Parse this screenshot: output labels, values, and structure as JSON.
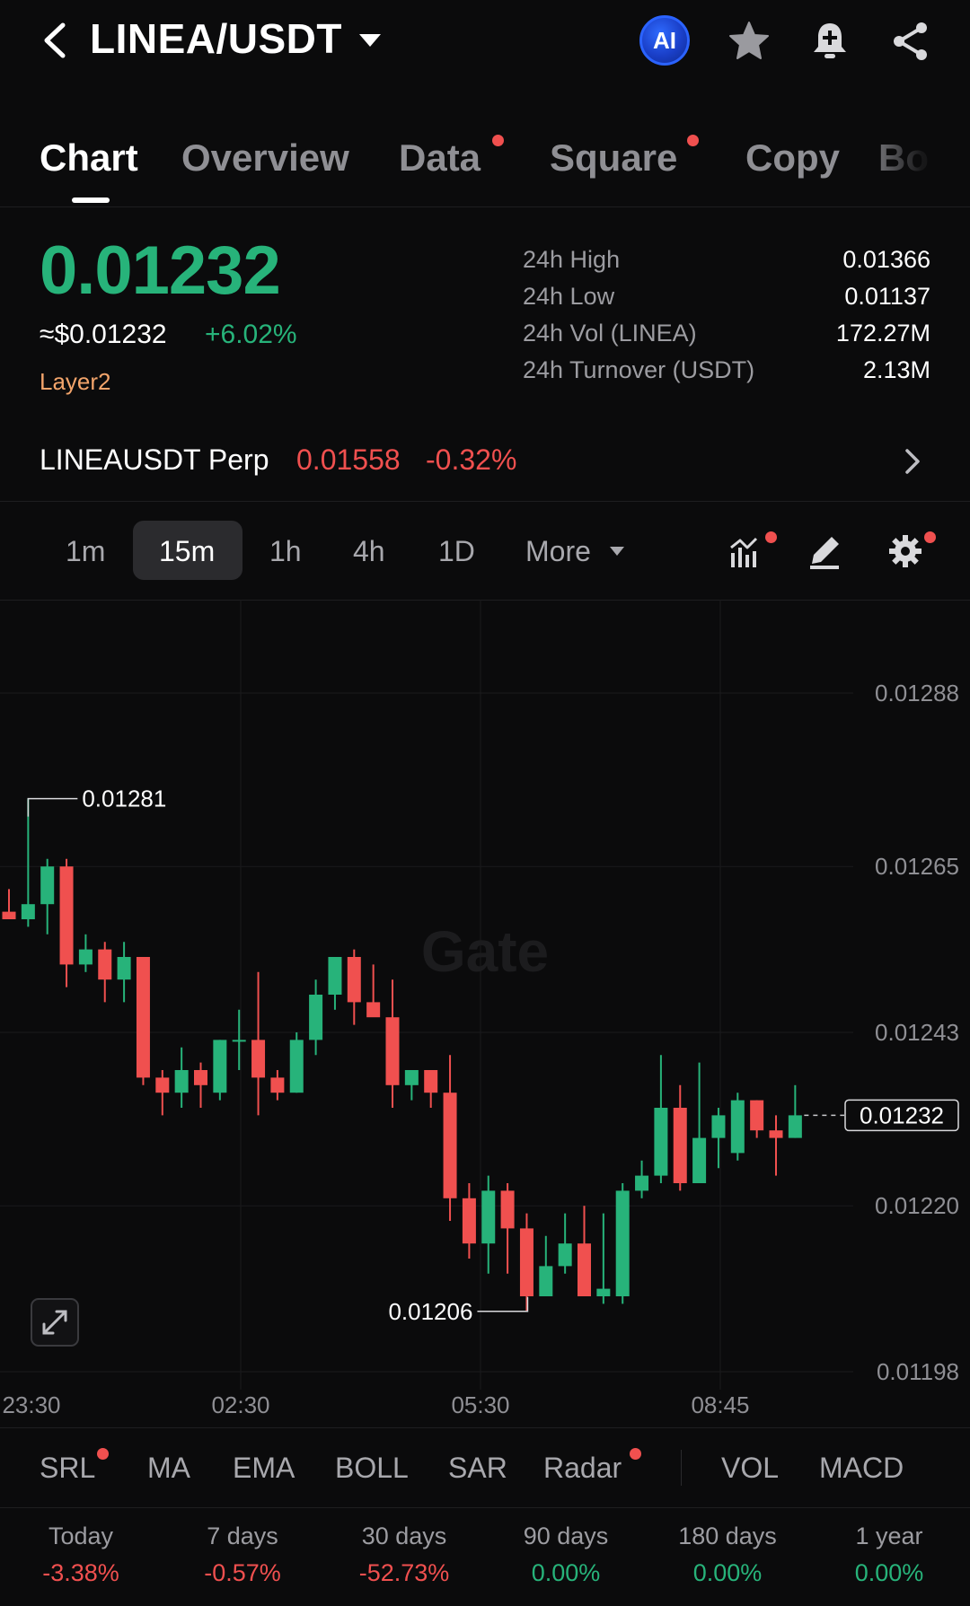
{
  "header": {
    "pair": "LINEA/USDT",
    "ai_label": "AI"
  },
  "tabs": [
    {
      "label": "Chart",
      "active": true,
      "dot": false
    },
    {
      "label": "Overview",
      "active": false,
      "dot": false
    },
    {
      "label": "Data",
      "active": false,
      "dot": true
    },
    {
      "label": "Square",
      "active": false,
      "dot": true
    },
    {
      "label": "Copy",
      "active": false,
      "dot": false
    },
    {
      "label": "Bo",
      "active": false,
      "dot": false
    }
  ],
  "price": {
    "last": "0.01232",
    "usd": "≈$0.01232",
    "change": "+6.02%",
    "tag": "Layer2"
  },
  "stats": [
    {
      "label": "24h High",
      "value": "0.01366"
    },
    {
      "label": "24h Low",
      "value": "0.01137"
    },
    {
      "label": "24h Vol (LINEA)",
      "value": "172.27M"
    },
    {
      "label": "24h Turnover (USDT)",
      "value": "2.13M"
    }
  ],
  "perp": {
    "name": "LINEAUSDT Perp",
    "price": "0.01558",
    "change": "-0.32%"
  },
  "intervals": [
    "1m",
    "15m",
    "1h",
    "4h",
    "1D"
  ],
  "interval_active": "15m",
  "more_label": "More",
  "colors": {
    "up": "#27b37a",
    "down": "#f0504f",
    "tag": "#f2a46b",
    "dot": "#f0504f"
  },
  "chart_data": {
    "type": "candlestick",
    "watermark": "Gate",
    "price_axis": [
      "0.01288",
      "0.01265",
      "0.01243",
      "0.01220",
      "0.01198"
    ],
    "ylim": [
      0.01198,
      0.01288
    ],
    "time_axis": [
      "23:30",
      "02:30",
      "05:30",
      "08:45"
    ],
    "high_marker": "0.01281",
    "low_marker": "0.01206",
    "current_price": "0.01232",
    "candles": [
      {
        "o": 0.01259,
        "h": 0.01262,
        "l": 0.01258,
        "c": 0.01258
      },
      {
        "o": 0.01258,
        "h": 0.01274,
        "l": 0.01257,
        "c": 0.0126
      },
      {
        "o": 0.0126,
        "h": 0.01266,
        "l": 0.01256,
        "c": 0.01265
      },
      {
        "o": 0.01265,
        "h": 0.01266,
        "l": 0.01249,
        "c": 0.01252
      },
      {
        "o": 0.01252,
        "h": 0.01256,
        "l": 0.01251,
        "c": 0.01254
      },
      {
        "o": 0.01254,
        "h": 0.01255,
        "l": 0.01247,
        "c": 0.0125
      },
      {
        "o": 0.0125,
        "h": 0.01255,
        "l": 0.01247,
        "c": 0.01253
      },
      {
        "o": 0.01253,
        "h": 0.01253,
        "l": 0.01236,
        "c": 0.01237
      },
      {
        "o": 0.01237,
        "h": 0.01238,
        "l": 0.01232,
        "c": 0.01235
      },
      {
        "o": 0.01235,
        "h": 0.01241,
        "l": 0.01233,
        "c": 0.01238
      },
      {
        "o": 0.01238,
        "h": 0.01239,
        "l": 0.01233,
        "c": 0.01236
      },
      {
        "o": 0.01235,
        "h": 0.01242,
        "l": 0.01234,
        "c": 0.01242
      },
      {
        "o": 0.01242,
        "h": 0.01246,
        "l": 0.01238,
        "c": 0.01242
      },
      {
        "o": 0.01242,
        "h": 0.01251,
        "l": 0.01232,
        "c": 0.01237
      },
      {
        "o": 0.01237,
        "h": 0.01238,
        "l": 0.01234,
        "c": 0.01235
      },
      {
        "o": 0.01235,
        "h": 0.01243,
        "l": 0.01235,
        "c": 0.01242
      },
      {
        "o": 0.01242,
        "h": 0.0125,
        "l": 0.0124,
        "c": 0.01248
      },
      {
        "o": 0.01248,
        "h": 0.01252,
        "l": 0.01246,
        "c": 0.01253
      },
      {
        "o": 0.01253,
        "h": 0.01254,
        "l": 0.01244,
        "c": 0.01247
      },
      {
        "o": 0.01247,
        "h": 0.01252,
        "l": 0.01246,
        "c": 0.01245
      },
      {
        "o": 0.01245,
        "h": 0.0125,
        "l": 0.01233,
        "c": 0.01236
      },
      {
        "o": 0.01236,
        "h": 0.01238,
        "l": 0.01234,
        "c": 0.01238
      },
      {
        "o": 0.01238,
        "h": 0.01237,
        "l": 0.01233,
        "c": 0.01235
      },
      {
        "o": 0.01235,
        "h": 0.0124,
        "l": 0.01218,
        "c": 0.01221
      },
      {
        "o": 0.01221,
        "h": 0.01223,
        "l": 0.01213,
        "c": 0.01215
      },
      {
        "o": 0.01215,
        "h": 0.01224,
        "l": 0.01211,
        "c": 0.01222
      },
      {
        "o": 0.01222,
        "h": 0.01223,
        "l": 0.01211,
        "c": 0.01217
      },
      {
        "o": 0.01217,
        "h": 0.01219,
        "l": 0.01206,
        "c": 0.01208
      },
      {
        "o": 0.01208,
        "h": 0.01216,
        "l": 0.01208,
        "c": 0.01212
      },
      {
        "o": 0.01212,
        "h": 0.01219,
        "l": 0.01211,
        "c": 0.01215
      },
      {
        "o": 0.01215,
        "h": 0.0122,
        "l": 0.01208,
        "c": 0.01208
      },
      {
        "o": 0.01208,
        "h": 0.01219,
        "l": 0.01207,
        "c": 0.01209
      },
      {
        "o": 0.01208,
        "h": 0.01223,
        "l": 0.01207,
        "c": 0.01222
      },
      {
        "o": 0.01222,
        "h": 0.01226,
        "l": 0.01221,
        "c": 0.01224
      },
      {
        "o": 0.01224,
        "h": 0.0124,
        "l": 0.01223,
        "c": 0.01233
      },
      {
        "o": 0.01233,
        "h": 0.01236,
        "l": 0.01222,
        "c": 0.01223
      },
      {
        "o": 0.01223,
        "h": 0.01239,
        "l": 0.01223,
        "c": 0.01229
      },
      {
        "o": 0.01229,
        "h": 0.01233,
        "l": 0.01225,
        "c": 0.01232
      },
      {
        "o": 0.01227,
        "h": 0.01235,
        "l": 0.01226,
        "c": 0.01234
      },
      {
        "o": 0.01234,
        "h": 0.01234,
        "l": 0.01229,
        "c": 0.0123
      },
      {
        "o": 0.0123,
        "h": 0.01232,
        "l": 0.01224,
        "c": 0.01229
      },
      {
        "o": 0.01229,
        "h": 0.01236,
        "l": 0.01229,
        "c": 0.01232
      }
    ]
  },
  "indicators": [
    "SRL",
    "MA",
    "EMA",
    "BOLL",
    "SAR",
    "Radar",
    "VOL",
    "MACD"
  ],
  "performance": [
    {
      "label": "Today",
      "value": "-3.38%",
      "dir": "down"
    },
    {
      "label": "7 days",
      "value": "-0.57%",
      "dir": "down"
    },
    {
      "label": "30 days",
      "value": "-52.73%",
      "dir": "down"
    },
    {
      "label": "90 days",
      "value": "0.00%",
      "dir": "flat"
    },
    {
      "label": "180 days",
      "value": "0.00%",
      "dir": "flat"
    },
    {
      "label": "1 year",
      "value": "0.00%",
      "dir": "flat"
    }
  ]
}
